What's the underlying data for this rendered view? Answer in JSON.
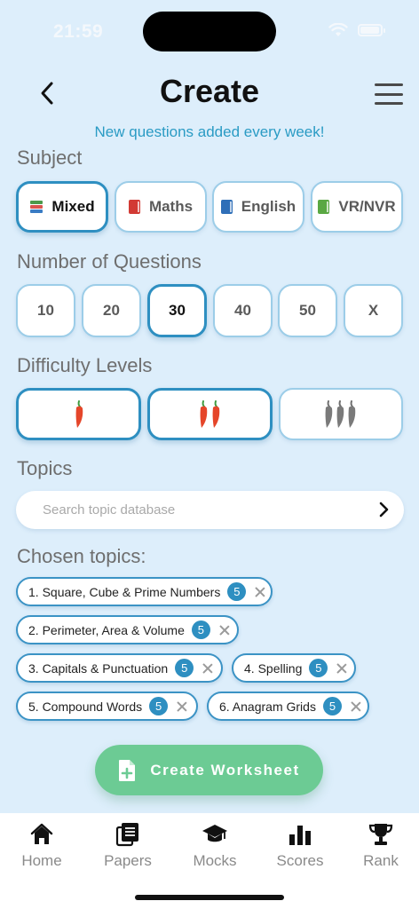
{
  "status_bar": {
    "time": "21:59"
  },
  "header": {
    "title": "Create",
    "subtitle": "New questions added every week!"
  },
  "subject": {
    "label": "Subject",
    "options": [
      {
        "label": "Mixed",
        "icon": "books-icon",
        "selected": true
      },
      {
        "label": "Maths",
        "icon": "red-book-icon",
        "selected": false
      },
      {
        "label": "English",
        "icon": "blue-book-icon",
        "selected": false
      },
      {
        "label": "VR/NVR",
        "icon": "green-book-icon",
        "selected": false
      }
    ]
  },
  "questions": {
    "label": "Number of Questions",
    "options": [
      "10",
      "20",
      "30",
      "40",
      "50",
      "X"
    ],
    "selected": "30"
  },
  "difficulty": {
    "label": "Difficulty Levels",
    "options": [
      {
        "level": 1,
        "icon": "chilli-pepper-icon",
        "selected": true
      },
      {
        "level": 2,
        "icon": "chilli-pepper-icon",
        "selected": true
      },
      {
        "level": 3,
        "icon": "chilli-pepper-icon",
        "selected": false
      }
    ]
  },
  "topics": {
    "label": "Topics",
    "search_placeholder": "Search topic database",
    "chosen_label": "Chosen topics:",
    "chosen": [
      {
        "label": "1. Square, Cube & Prime Numbers",
        "count": "5"
      },
      {
        "label": "2. Perimeter, Area & Volume",
        "count": "5"
      },
      {
        "label": "3. Capitals & Punctuation",
        "count": "5"
      },
      {
        "label": "4. Spelling",
        "count": "5"
      },
      {
        "label": "5. Compound Words",
        "count": "5"
      },
      {
        "label": "6. Anagram Grids",
        "count": "5"
      }
    ]
  },
  "create_button": {
    "label": "Create Worksheet"
  },
  "tab_bar": {
    "items": [
      {
        "label": "Home",
        "icon": "home-icon"
      },
      {
        "label": "Papers",
        "icon": "papers-icon"
      },
      {
        "label": "Mocks",
        "icon": "graduation-cap-icon"
      },
      {
        "label": "Scores",
        "icon": "bar-chart-icon"
      },
      {
        "label": "Rank",
        "icon": "trophy-icon"
      }
    ]
  },
  "colors": {
    "background": "#ddeefb",
    "accent": "#2e8fc1",
    "subtitle": "#2a9bc4",
    "create_button": "#6ccb94",
    "chilli_active": "#e5462a",
    "chilli_inactive": "#7a7a7a"
  }
}
